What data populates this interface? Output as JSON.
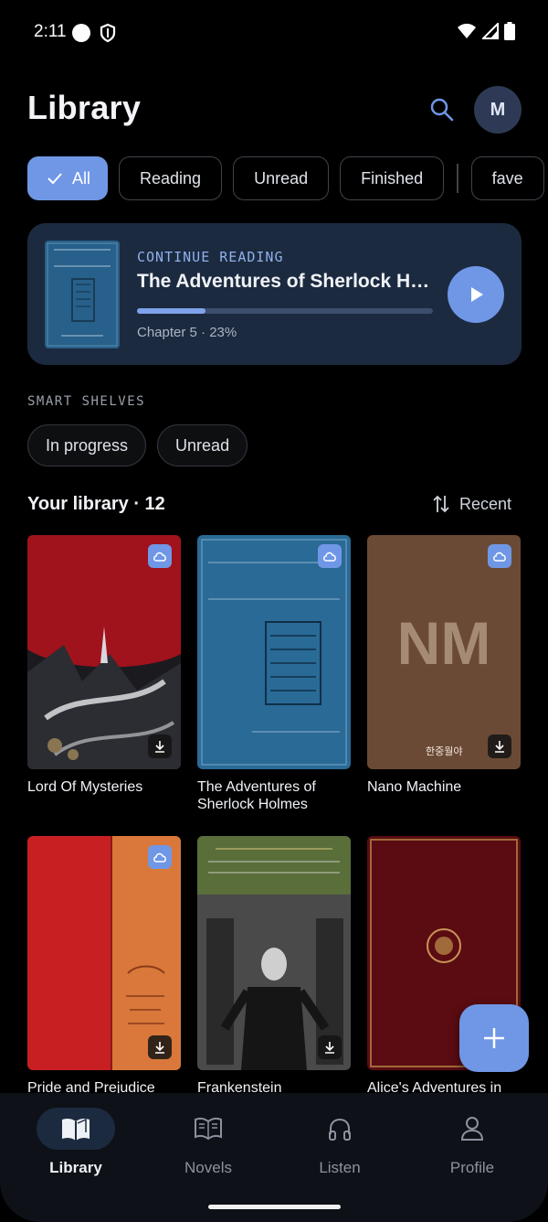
{
  "status_bar": {
    "time": "2:11"
  },
  "header": {
    "title": "Library",
    "avatar_initial": "M"
  },
  "filters": [
    {
      "label": "All",
      "active": true
    },
    {
      "label": "Reading",
      "active": false
    },
    {
      "label": "Unread",
      "active": false
    },
    {
      "label": "Finished",
      "active": false
    },
    {
      "label": "fave",
      "active": false
    }
  ],
  "continue_reading": {
    "eyebrow": "CONTINUE READING",
    "title": "The Adventures of Sherlock Holmes",
    "meta": "Chapter 5 · 23%",
    "progress": 0.23
  },
  "smart_shelves": {
    "heading": "SMART SHELVES",
    "items": [
      "In progress",
      "Unread"
    ]
  },
  "library": {
    "heading": "Your library · 12",
    "sort_label": "Recent",
    "books": [
      {
        "title": "Lord Of Mysteries",
        "cloud": true,
        "download": true
      },
      {
        "title": "The Adventures of Sherlock Holmes",
        "cloud": true,
        "download": false
      },
      {
        "title": "Nano Machine",
        "cloud": true,
        "download": true,
        "cover_text": "NM",
        "cover_sub": "한중월야"
      },
      {
        "title": "Pride and Prejudice",
        "cloud": true,
        "download": true
      },
      {
        "title": "Frankenstein",
        "cloud": false,
        "download": true
      },
      {
        "title": "Alice's Adventures in",
        "cloud": false,
        "download": false
      }
    ]
  },
  "bottom_nav": [
    {
      "label": "Library",
      "active": true
    },
    {
      "label": "Novels",
      "active": false
    },
    {
      "label": "Listen",
      "active": false
    },
    {
      "label": "Profile",
      "active": false
    }
  ]
}
